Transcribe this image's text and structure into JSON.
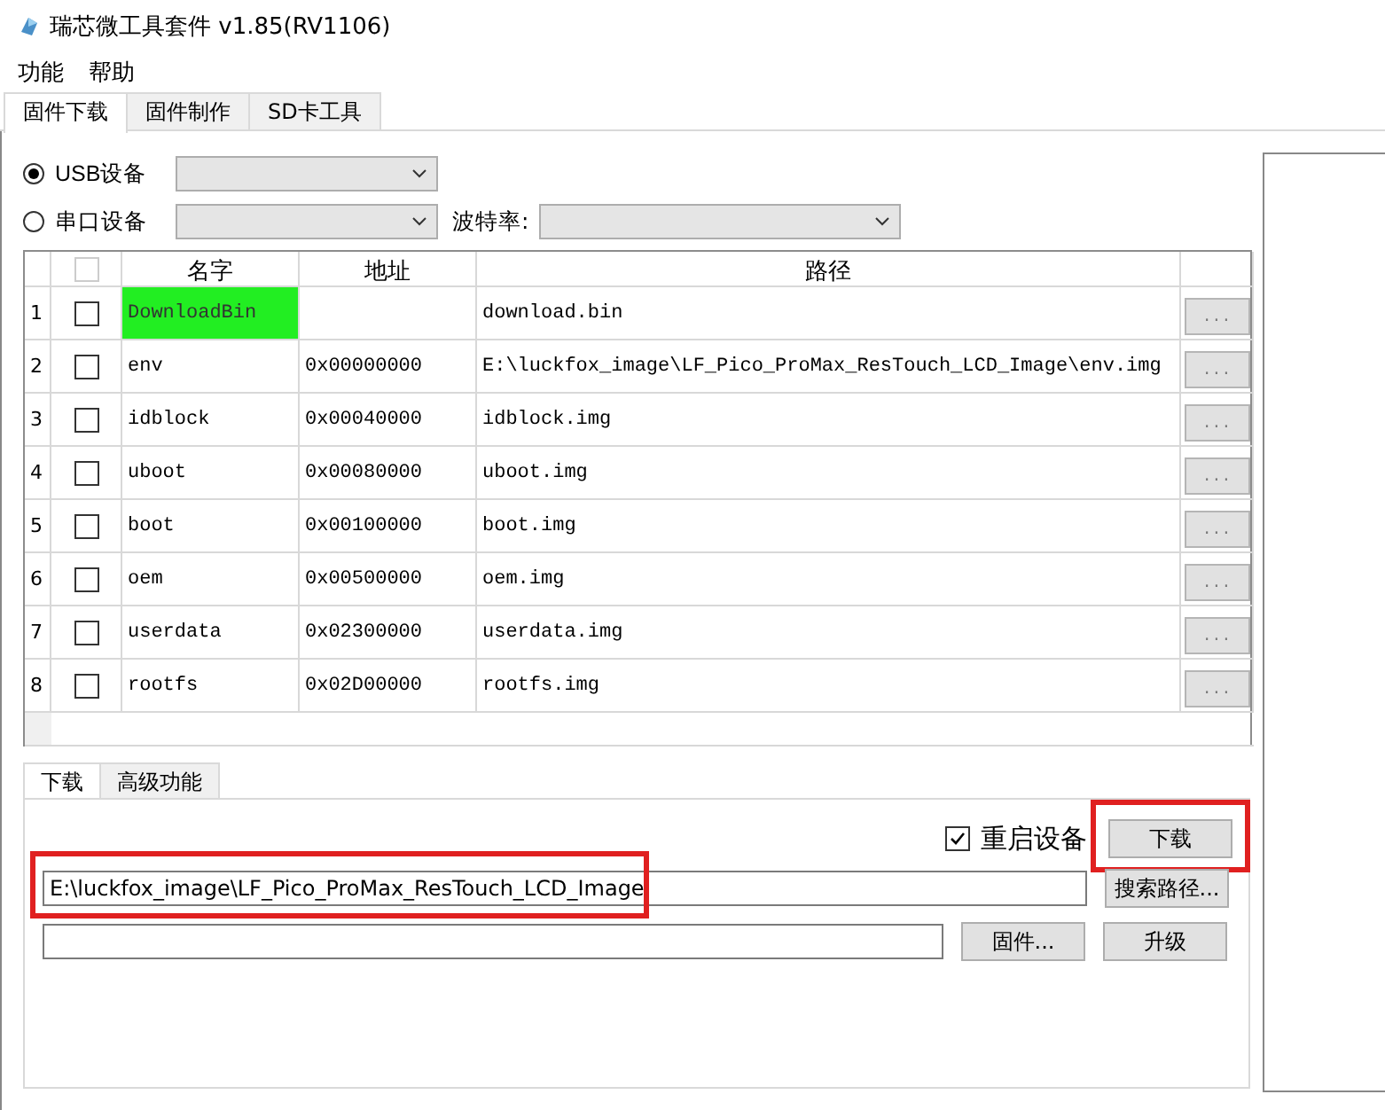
{
  "window": {
    "title": "瑞芯微工具套件 v1.85(RV1106)"
  },
  "menu": [
    "功能",
    "帮助"
  ],
  "tabs": [
    {
      "label": "固件下载",
      "selected": true
    },
    {
      "label": "固件制作",
      "selected": false
    },
    {
      "label": "SD卡工具",
      "selected": false
    }
  ],
  "device": {
    "options": [
      {
        "label": "USB设备",
        "selected": true
      },
      {
        "label": "串口设备",
        "selected": false
      }
    ],
    "baud_label": "波特率:"
  },
  "table": {
    "columns": [
      "名字",
      "地址",
      "路径"
    ],
    "header_checkbox": {
      "checked": false,
      "disabled": true
    },
    "rows": [
      {
        "index": "1",
        "checked": false,
        "name": "DownloadBin",
        "highlighted": true,
        "path": "download.bin",
        "browse": "..."
      },
      {
        "index": "2",
        "checked": false,
        "name": "env",
        "highlighted": false,
        "address": "0x00000000",
        "path": "E:\\luckfox_image\\LF_Pico_ProMax_ResTouch_LCD_Image\\env.img",
        "browse": "..."
      },
      {
        "index": "3",
        "checked": false,
        "name": "idblock",
        "highlighted": false,
        "address": "0x00040000",
        "path": "idblock.img",
        "browse": "..."
      },
      {
        "index": "4",
        "checked": false,
        "name": "uboot",
        "highlighted": false,
        "address": "0x00080000",
        "path": "uboot.img",
        "browse": "..."
      },
      {
        "index": "5",
        "checked": false,
        "name": "boot",
        "highlighted": false,
        "address": "0x00100000",
        "path": "boot.img",
        "browse": "..."
      },
      {
        "index": "6",
        "checked": false,
        "name": "oem",
        "highlighted": false,
        "address": "0x00500000",
        "path": "oem.img",
        "browse": "..."
      },
      {
        "index": "7",
        "checked": false,
        "name": "userdata",
        "highlighted": false,
        "address": "0x02300000",
        "path": "userdata.img",
        "browse": "..."
      },
      {
        "index": "8",
        "checked": false,
        "name": "rootfs",
        "highlighted": false,
        "address": "0x02D00000",
        "path": "rootfs.img",
        "browse": "..."
      }
    ]
  },
  "lower_tabs": [
    {
      "label": "下载",
      "selected": true
    },
    {
      "label": "高级功能",
      "selected": false
    }
  ],
  "download_panel": {
    "reboot": {
      "label": "重启设备",
      "checked": true
    },
    "download_button": {
      "label": "下载",
      "annotated": true
    },
    "path_field": {
      "value": "E:\\luckfox_image\\LF_Pico_ProMax_ResTouch_LCD_Image",
      "annotated": true
    },
    "search_button": "搜索路径...",
    "firmware_button": "固件...",
    "upgrade_button": "升级"
  }
}
